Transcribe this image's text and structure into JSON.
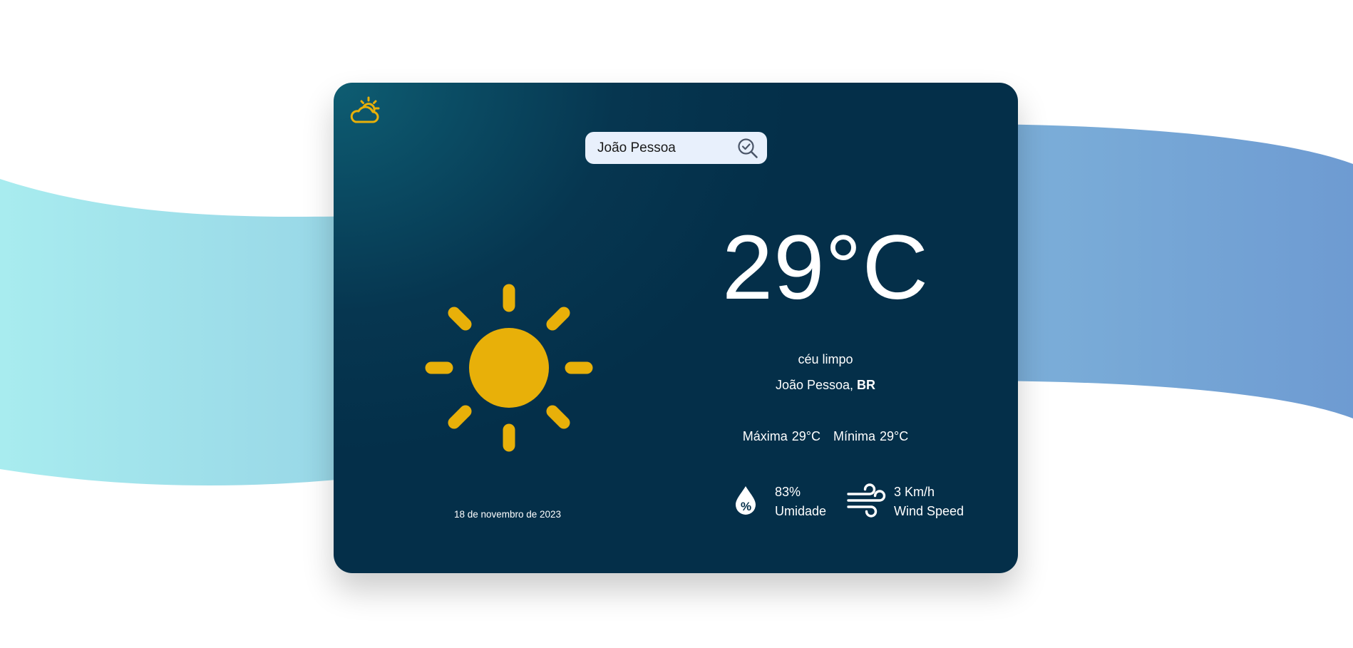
{
  "search": {
    "value": "João Pessoa"
  },
  "weather": {
    "temperature": "29°C",
    "description": "céu limpo",
    "city": "João Pessoa,",
    "country": "BR",
    "max_label": "Máxima 29°C",
    "min_label": "Mínima 29°C",
    "date": "18 de novembro de 2023"
  },
  "details": {
    "humidity_value": "83%",
    "humidity_label": "Umidade",
    "wind_value": "3 Km/h",
    "wind_label": "Wind Speed"
  },
  "colors": {
    "card_dark": "#042f49",
    "card_light": "#0e5d72",
    "accent_sun": "#e8b009",
    "search_bg": "#e8f0fc",
    "wave_left": "#a8ecef",
    "wave_right": "#6e9bd2"
  },
  "icons": [
    "partly-cloudy-icon",
    "search-icon",
    "sun-icon",
    "humidity-icon",
    "wind-icon"
  ]
}
